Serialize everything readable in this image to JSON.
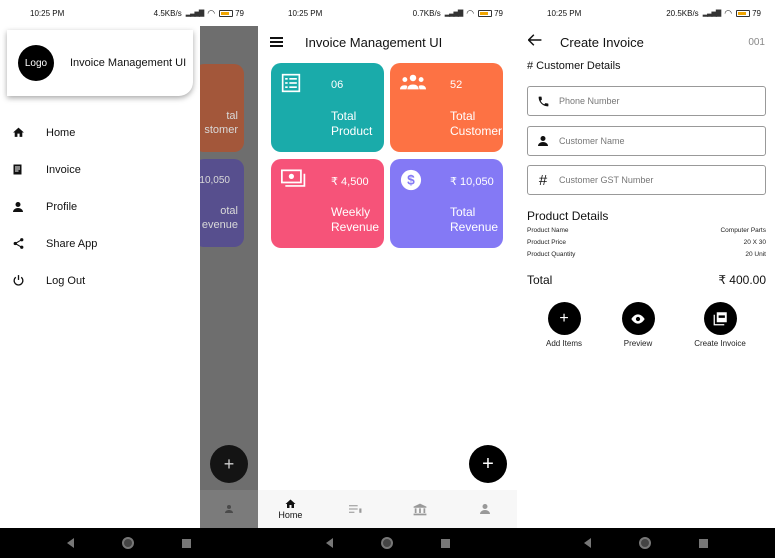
{
  "panel1": {
    "status": {
      "time": "10:25 PM",
      "net": "4.5KB/s",
      "battery": "79"
    },
    "drawer": {
      "logo": "Logo",
      "title": "Invoice Management UI",
      "items": [
        {
          "label": "Home",
          "icon": "home-icon"
        },
        {
          "label": "Invoice",
          "icon": "invoice-icon"
        },
        {
          "label": "Profile",
          "icon": "person-icon"
        },
        {
          "label": "Share App",
          "icon": "share-icon"
        },
        {
          "label": "Log Out",
          "icon": "power-icon"
        }
      ]
    },
    "peek": {
      "orange_label": "tal\nstomer",
      "purple_num": "10,050",
      "purple_label": "otal\nevenue"
    }
  },
  "panel2": {
    "status": {
      "time": "10:25 PM",
      "net": "0.7KB/s",
      "battery": "79"
    },
    "title": "Invoice Management UI",
    "tiles": [
      {
        "value": "06",
        "label1": "Total",
        "label2": "Product",
        "icon": "list-icon",
        "color": "#1aabaa"
      },
      {
        "value": "52",
        "label1": "Total",
        "label2": "Customer",
        "icon": "group-icon",
        "color": "#fd7244"
      },
      {
        "value": "₹ 4,500",
        "label1": "Weekly",
        "label2": "Revenue",
        "icon": "money-icon",
        "color": "#f65379"
      },
      {
        "value": "₹ 10,050",
        "label1": "Total",
        "label2": "Revenue",
        "icon": "dollar-icon",
        "color": "#8479f5"
      }
    ],
    "fab": "+",
    "bottom_nav": {
      "home_label": "Home"
    }
  },
  "panel3": {
    "status": {
      "time": "10:25 PM",
      "net": "20.5KB/s",
      "battery": "79"
    },
    "title": "Create Invoice",
    "invoice_number": "001",
    "customer_section": "# Customer Details",
    "fields": {
      "phone": "Phone Number",
      "name": "Customer Name",
      "gst": "Customer GST Number"
    },
    "product_section": "Product Details",
    "product_rows": [
      {
        "label": "Product Name",
        "value": "Computer Parts"
      },
      {
        "label": "Product Price",
        "value": "20 X 30"
      },
      {
        "label": "Product Quantity",
        "value": "20 Unit"
      }
    ],
    "total_label": "Total",
    "total_value": "₹ 400.00",
    "actions": {
      "add": "Add Items",
      "preview": "Preview",
      "create": "Create Invoice"
    }
  }
}
